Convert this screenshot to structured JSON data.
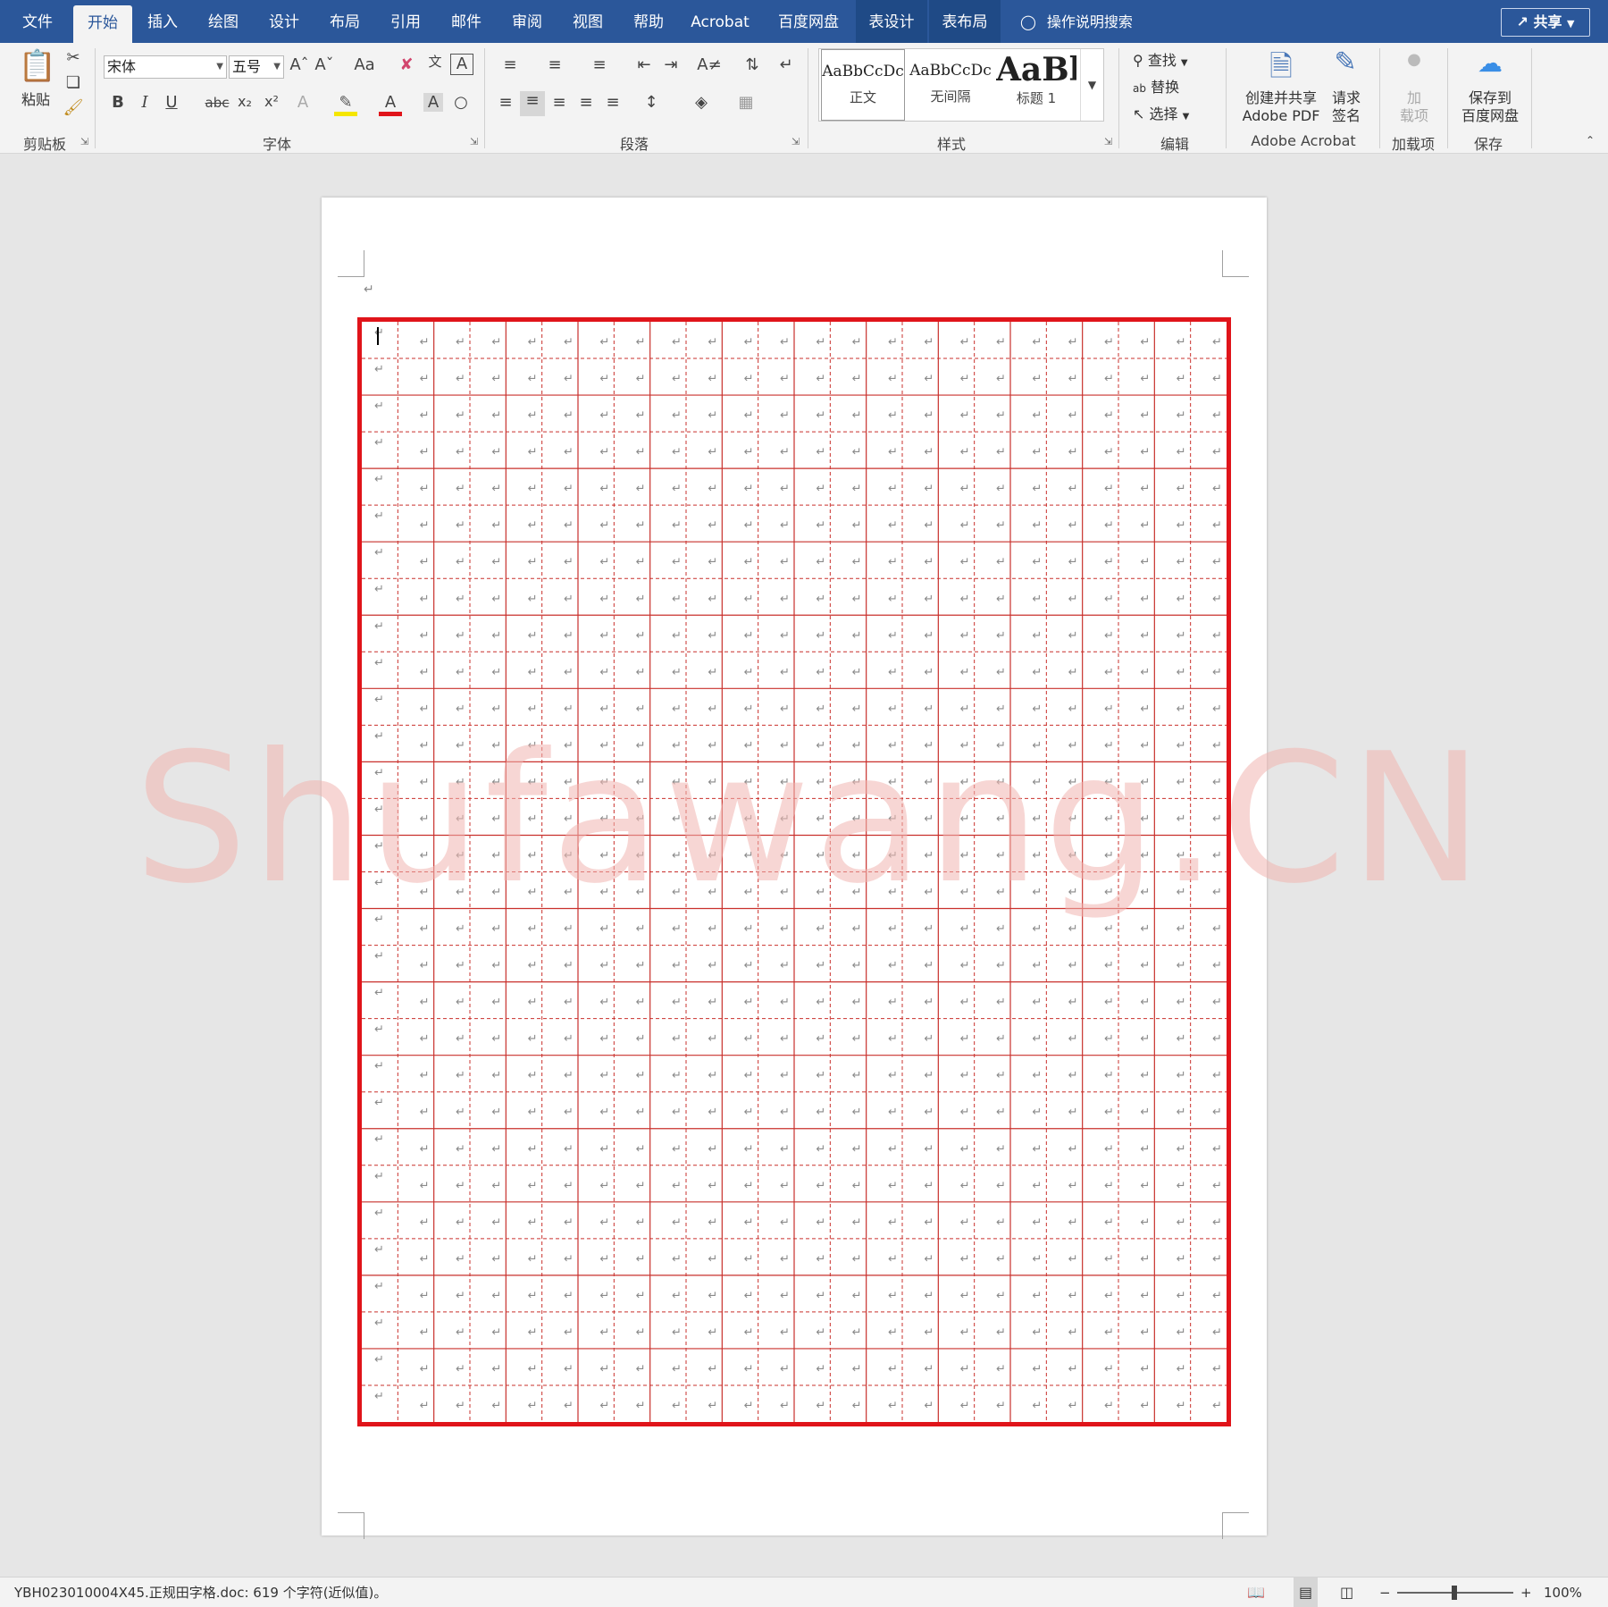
{
  "tabs": [
    {
      "label": "文件"
    },
    {
      "label": "开始"
    },
    {
      "label": "插入"
    },
    {
      "label": "绘图"
    },
    {
      "label": "设计"
    },
    {
      "label": "布局"
    },
    {
      "label": "引用"
    },
    {
      "label": "邮件"
    },
    {
      "label": "审阅"
    },
    {
      "label": "视图"
    },
    {
      "label": "帮助"
    },
    {
      "label": "Acrobat"
    },
    {
      "label": "百度网盘"
    },
    {
      "label": "表设计"
    },
    {
      "label": "表布局"
    }
  ],
  "active_tab": "开始",
  "tell_me": "操作说明搜索",
  "share_label": "共享",
  "ribbon": {
    "clipboard": {
      "paste": "粘贴",
      "group": "剪贴板"
    },
    "font": {
      "name": "宋体",
      "size": "五号",
      "case": "Aa",
      "group": "字体",
      "bold": "B",
      "italic": "I",
      "underline": "U",
      "strike": "abc",
      "sub": "x₂",
      "sup": "x²"
    },
    "paragraph": {
      "group": "段落"
    },
    "styles": {
      "group": "样式",
      "items": [
        {
          "sample": "AaBbCcDc",
          "name": "正文"
        },
        {
          "sample": "AaBbCcDc",
          "name": "无间隔"
        },
        {
          "sample": "AaBl",
          "name": "标题 1"
        }
      ]
    },
    "editing": {
      "find": "查找",
      "replace": "替换",
      "select": "选择",
      "group": "编辑"
    },
    "acrobat": {
      "create_pdf_1": "创建并共享",
      "create_pdf_2": "Adobe PDF",
      "sign_1": "请求",
      "sign_2": "签名",
      "group": "Adobe Acrobat"
    },
    "addins": {
      "label_1": "加",
      "label_2": "载项",
      "group": "加载项"
    },
    "save": {
      "label_1": "保存到",
      "label_2": "百度网盘",
      "group": "保存"
    }
  },
  "document": {
    "grid_rows": 15,
    "grid_cols": 12,
    "paragraph_mark": "↵",
    "cell_mark": "↵",
    "border_color": "#e0141a",
    "line_color": "#c9302c"
  },
  "watermark": "Shufawang.CN",
  "status": {
    "text": "YBH023010004X45.正规田字格.doc: 619 个字符(近似值)。",
    "zoom": "100%"
  }
}
